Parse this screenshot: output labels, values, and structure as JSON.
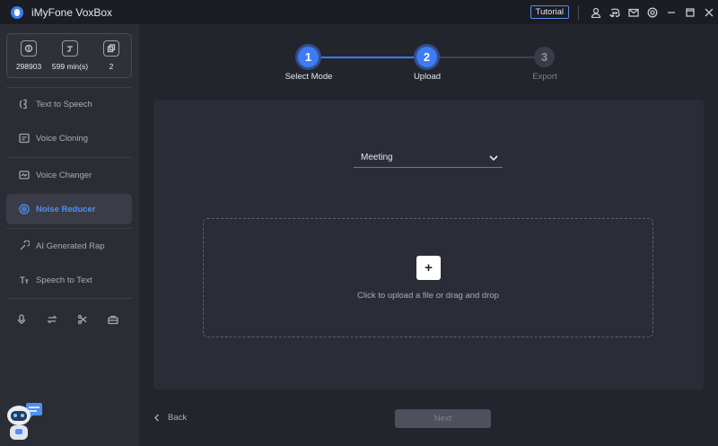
{
  "app": {
    "title": "iMyFone VoxBox"
  },
  "titlebar": {
    "tutorial_label": "Tutorial",
    "icons": [
      "user-icon",
      "discord-icon",
      "mail-icon",
      "settings-icon",
      "minimize-icon",
      "maximize-icon",
      "close-icon"
    ]
  },
  "stats": [
    {
      "icon": "characters-icon",
      "value": "298903"
    },
    {
      "icon": "minutes-icon",
      "value": "599 min(s)"
    },
    {
      "icon": "count-icon",
      "value": "2"
    }
  ],
  "sidebar": {
    "items": [
      {
        "label": "Text to Speech",
        "icon": "tts-icon",
        "active": false
      },
      {
        "label": "Voice Cloning",
        "icon": "clone-icon",
        "active": false
      },
      {
        "label": "Voice Changer",
        "icon": "changer-icon",
        "active": false
      },
      {
        "label": "Noise Reducer",
        "icon": "noise-icon",
        "active": true
      },
      {
        "label": "AI Generated Rap",
        "icon": "rap-icon",
        "active": false
      },
      {
        "label": "Speech to Text",
        "icon": "stt-icon",
        "active": false
      }
    ],
    "tools": [
      "microphone-icon",
      "convert-icon",
      "cut-icon",
      "toolbox-icon"
    ]
  },
  "stepper": {
    "steps": [
      {
        "number": "1",
        "label": "Select Mode",
        "state": "done"
      },
      {
        "number": "2",
        "label": "Upload",
        "state": "done"
      },
      {
        "number": "3",
        "label": "Export",
        "state": "todo"
      }
    ]
  },
  "main": {
    "mode_select": {
      "value": "Meeting"
    },
    "dropzone": {
      "plus": "+",
      "text": "Click to upload a file or drag and drop"
    }
  },
  "footer": {
    "back_label": "Back",
    "next_label": "Next"
  },
  "colors": {
    "accent": "#3d7bf7",
    "background": "#23252d",
    "sidebar": "#2b2d35",
    "panel": "#2b2d36"
  }
}
